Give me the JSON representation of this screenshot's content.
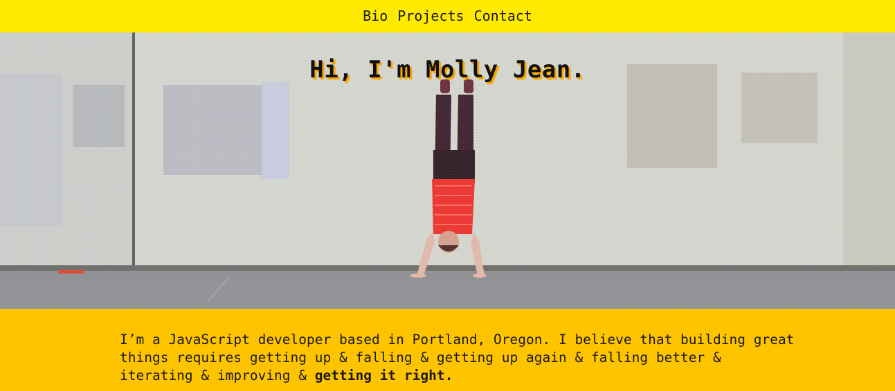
{
  "nav": {
    "items": [
      {
        "label": "Bio"
      },
      {
        "label": "Projects"
      },
      {
        "label": "Contact"
      }
    ]
  },
  "hero": {
    "title": "Hi, I'm Molly Jean."
  },
  "bio": {
    "text": "I’m a JavaScript developer based in Portland, Oregon. I believe that building great things requires getting up & falling & getting up again & falling better & iterating & improving & ",
    "emphasis": "getting it right."
  },
  "colors": {
    "nav_background": "#ffea00",
    "bio_background": "#ffc400",
    "title_shadow": "#f7a700",
    "shirt": "#f0302a"
  }
}
